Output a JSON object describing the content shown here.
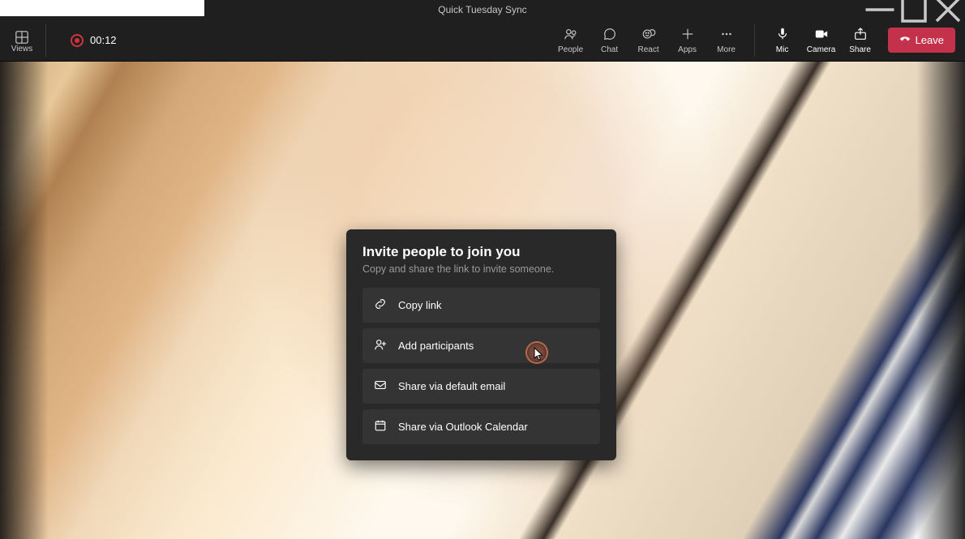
{
  "titlebar": {
    "title": "Quick Tuesday Sync"
  },
  "toolbar": {
    "views_label": "Views",
    "timer": "00:12",
    "people_label": "People",
    "chat_label": "Chat",
    "react_label": "React",
    "apps_label": "Apps",
    "more_label": "More",
    "mic_label": "Mic",
    "camera_label": "Camera",
    "share_label": "Share",
    "leave_label": "Leave"
  },
  "modal": {
    "title": "Invite people to join you",
    "subtitle": "Copy and share the link to invite someone.",
    "options": {
      "copy_link": "Copy link",
      "add_participants": "Add participants",
      "share_email": "Share via default email",
      "share_outlook": "Share via Outlook Calendar"
    }
  }
}
